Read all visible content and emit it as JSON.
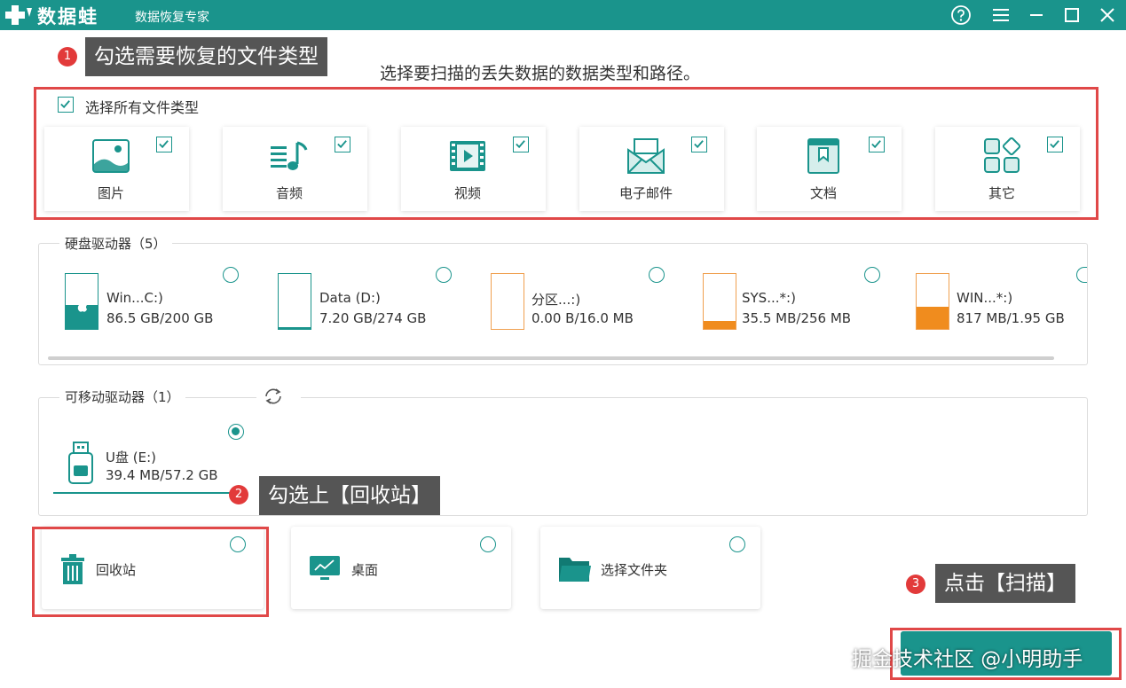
{
  "app": {
    "name": "数据蛙",
    "subtitle": "数据恢复专家",
    "accent_color": "#1a948c",
    "titlebar_icons": [
      "help-icon",
      "menu-icon",
      "minimize-icon",
      "maximize-icon",
      "close-icon"
    ]
  },
  "callouts": [
    {
      "number": "1",
      "text": "勾选需要恢复的文件类型"
    },
    {
      "number": "2",
      "text": "勾选上【回收站】"
    },
    {
      "number": "3",
      "text": "点击【扫描】"
    }
  ],
  "instruction": "选择要扫描的丢失数据的数据类型和路径。",
  "file_types": {
    "select_all_label": "选择所有文件类型",
    "select_all_checked": true,
    "items": [
      {
        "label": "图片",
        "icon": "image-icon",
        "checked": true
      },
      {
        "label": "音频",
        "icon": "audio-icon",
        "checked": true
      },
      {
        "label": "视频",
        "icon": "video-icon",
        "checked": true
      },
      {
        "label": "电子邮件",
        "icon": "email-icon",
        "checked": true
      },
      {
        "label": "文档",
        "icon": "document-icon",
        "checked": true
      },
      {
        "label": "其它",
        "icon": "other-icon",
        "checked": true
      }
    ]
  },
  "disk_drives": {
    "title": "硬盘驱动器（5）",
    "items": [
      {
        "name": "Win...C:)",
        "size": "86.5 GB/200 GB",
        "fill_fraction": 0.43,
        "color": "#1a948c",
        "selected": false
      },
      {
        "name": "Data (D:)",
        "size": "7.20 GB/274 GB",
        "fill_fraction": 0.03,
        "color": "#1a948c",
        "selected": false
      },
      {
        "name": "分区...:)",
        "size": "0.00  B/16.0 MB",
        "fill_fraction": 0.0,
        "color": "#f0a050",
        "selected": false
      },
      {
        "name": "SYS...*:)",
        "size": "35.5 MB/256 MB",
        "fill_fraction": 0.14,
        "color": "#f08c1e",
        "selected": false
      },
      {
        "name": "WIN...*:)",
        "size": "817 MB/1.95 GB",
        "fill_fraction": 0.41,
        "color": "#f08c1e",
        "selected": false
      }
    ]
  },
  "removable_drives": {
    "title": "可移动驱动器（1）",
    "items": [
      {
        "name": "U盘 (E:)",
        "size": "39.4 MB/57.2 GB",
        "selected": true
      }
    ]
  },
  "locations": [
    {
      "label": "回收站",
      "icon": "recycle-bin-icon",
      "selected": false
    },
    {
      "label": "桌面",
      "icon": "desktop-icon",
      "selected": false
    },
    {
      "label": "选择文件夹",
      "icon": "folder-icon",
      "selected": false
    }
  ],
  "watermark": "掘金技术社区 @小明助手"
}
